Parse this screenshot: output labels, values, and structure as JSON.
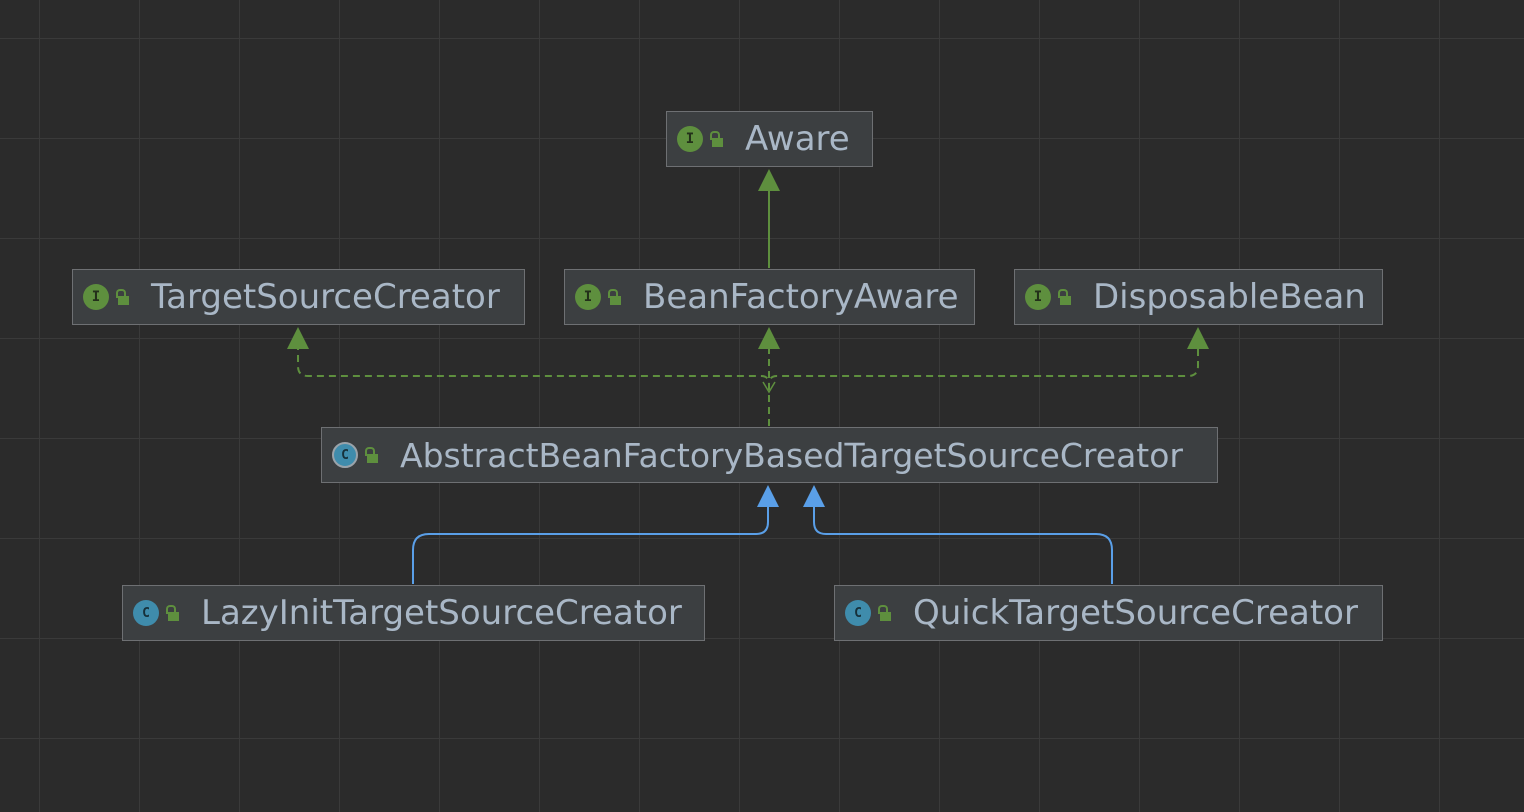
{
  "nodes": {
    "aware": {
      "label": "Aware",
      "kind": "interface"
    },
    "target_source_creator": {
      "label": "TargetSourceCreator",
      "kind": "interface"
    },
    "bean_factory_aware": {
      "label": "BeanFactoryAware",
      "kind": "interface"
    },
    "disposable_bean": {
      "label": "DisposableBean",
      "kind": "interface"
    },
    "abstract_creator": {
      "label": "AbstractBeanFactoryBasedTargetSourceCreator",
      "kind": "abstract-class"
    },
    "lazy_init_creator": {
      "label": "LazyInitTargetSourceCreator",
      "kind": "class"
    },
    "quick_creator": {
      "label": "QuickTargetSourceCreator",
      "kind": "class"
    }
  },
  "edges": [
    {
      "from": "BeanFactoryAware",
      "to": "Aware",
      "type": "extends"
    },
    {
      "from": "AbstractBeanFactoryBasedTargetSourceCreator",
      "to": "TargetSourceCreator",
      "type": "implements"
    },
    {
      "from": "AbstractBeanFactoryBasedTargetSourceCreator",
      "to": "BeanFactoryAware",
      "type": "implements"
    },
    {
      "from": "AbstractBeanFactoryBasedTargetSourceCreator",
      "to": "DisposableBean",
      "type": "implements"
    },
    {
      "from": "LazyInitTargetSourceCreator",
      "to": "AbstractBeanFactoryBasedTargetSourceCreator",
      "type": "extends"
    },
    {
      "from": "QuickTargetSourceCreator",
      "to": "AbstractBeanFactoryBasedTargetSourceCreator",
      "type": "extends"
    }
  ],
  "icons": {
    "interface": {
      "name": "interface-icon",
      "letter": "I"
    },
    "class": {
      "name": "class-icon",
      "letter": "C"
    },
    "abstract": {
      "name": "abstract-class-icon",
      "letter": "C"
    },
    "visibility": {
      "name": "public-lock-icon"
    }
  },
  "colors": {
    "background": "#2b2b2b",
    "node_fill": "#3c3f41",
    "node_border": "#6e7073",
    "text": "#a9b7c6",
    "interface_edge": "#5e8f3e",
    "class_edge": "#5a9fe8"
  }
}
